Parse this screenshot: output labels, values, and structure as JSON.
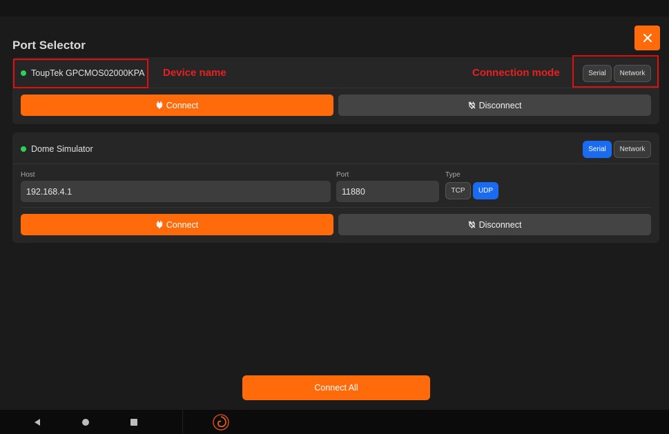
{
  "window": {
    "title": "Port Selector"
  },
  "annotations": {
    "device_name": "Device name",
    "connection_mode": "Connection mode"
  },
  "devices": [
    {
      "name": "ToupTek GPCMOS02000KPA",
      "status_color": "#2ed157",
      "mode": {
        "serial_label": "Serial",
        "network_label": "Network",
        "selected": "none"
      },
      "connect_label": "Connect",
      "disconnect_label": "Disconnect"
    },
    {
      "name": "Dome Simulator",
      "status_color": "#2ed157",
      "mode": {
        "serial_label": "Serial",
        "network_label": "Network",
        "selected": "Serial"
      },
      "host": {
        "label": "Host",
        "value": "192.168.4.1"
      },
      "port": {
        "label": "Port",
        "value": "11880"
      },
      "type": {
        "label": "Type",
        "tcp_label": "TCP",
        "udp_label": "UDP",
        "selected": "UDP"
      },
      "connect_label": "Connect",
      "disconnect_label": "Disconnect"
    }
  ],
  "footer": {
    "connect_all_label": "Connect All"
  },
  "colors": {
    "accent": "#ff6b0a",
    "selected_blue": "#1a6bf0",
    "status_green": "#2ed157"
  },
  "icons": [
    "close-icon",
    "plug-icon",
    "unplug-icon",
    "nav-back-icon",
    "nav-home-icon",
    "nav-recents-icon",
    "app-spiral-icon"
  ]
}
